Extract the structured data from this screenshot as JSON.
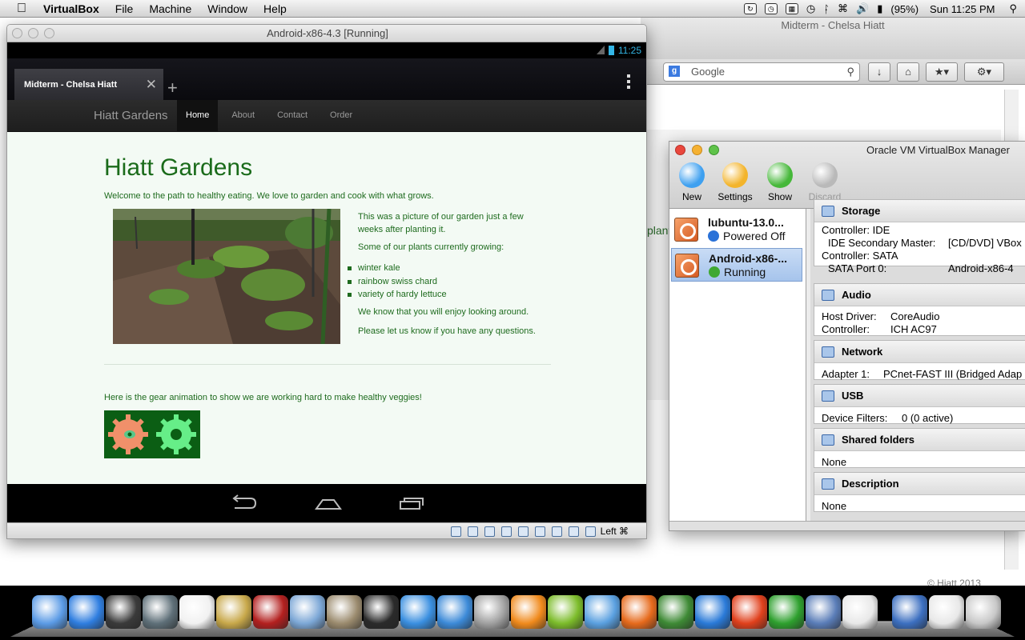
{
  "menubar": {
    "app_name": "VirtualBox",
    "items": [
      "File",
      "Machine",
      "Window",
      "Help"
    ],
    "battery": "(95%)",
    "clock": "Sun 11:25 PM"
  },
  "bg_browser": {
    "title": "Midterm - Chelsa Hiatt",
    "search_placeholder": "Google",
    "partial_text": "plant",
    "footer_text": "© Hiatt 2013"
  },
  "vm_window": {
    "title": "Android-x86-4.3 [Running]",
    "host_key": "Left ⌘",
    "android": {
      "status_time": "11:25",
      "tab_title": "Midterm - Chelsa Hiatt",
      "new_tab": "+",
      "site": {
        "brand": "Hiatt Gardens",
        "nav": [
          "Home",
          "About",
          "Contact",
          "Order"
        ],
        "heading": "Hiatt Gardens",
        "intro": "Welcome to the path to healthy eating. We love to garden and cook with what grows.",
        "caption": "This was a picture of our garden just a few weeks after planting it.",
        "plants_intro": "Some of our plants currently growing:",
        "plants": [
          "winter kale",
          "rainbow swiss chard",
          "variety of hardy lettuce"
        ],
        "enjoy": "We know that you will enjoy looking around.",
        "questions": "Please let us know if you have any questions.",
        "gear_text": "Here is the gear animation to show we are working hard to make healthy veggies!"
      }
    }
  },
  "manager": {
    "title": "Oracle VM VirtualBox Manager",
    "toolbar": [
      {
        "label": "New",
        "color": "#3ea0f0"
      },
      {
        "label": "Settings",
        "color": "#f3b42b"
      },
      {
        "label": "Show",
        "color": "#46b83a"
      },
      {
        "label": "Discard",
        "color": "#b9b9b9"
      }
    ],
    "vms": [
      {
        "name": "lubuntu-13.0...",
        "state": "Powered Off",
        "state_color": "#2a72d8"
      },
      {
        "name": "Android-x86-...",
        "state": "Running",
        "state_color": "#3fa832"
      }
    ],
    "sections": {
      "storage": {
        "title": "Storage",
        "rows": [
          [
            "Controller: IDE",
            ""
          ],
          [
            "IDE Secondary Master:",
            "[CD/DVD] VBox"
          ],
          [
            "Controller: SATA",
            ""
          ],
          [
            "SATA Port 0:",
            "Android-x86-4"
          ]
        ]
      },
      "audio": {
        "title": "Audio",
        "rows": [
          [
            "Host Driver:",
            "CoreAudio"
          ],
          [
            "Controller:",
            "ICH AC97"
          ]
        ]
      },
      "network": {
        "title": "Network",
        "rows": [
          [
            "Adapter 1:",
            "PCnet-FAST III (Bridged Adap"
          ]
        ]
      },
      "usb": {
        "title": "USB",
        "rows": [
          [
            "Device Filters:",
            "0 (0 active)"
          ]
        ]
      },
      "shared": {
        "title": "Shared folders",
        "rows": [
          [
            "None",
            ""
          ]
        ]
      },
      "description": {
        "title": "Description",
        "rows": [
          [
            "None",
            ""
          ]
        ]
      }
    }
  },
  "dock": {
    "apps": [
      {
        "name": "finder-icon",
        "color": "#5b9be6"
      },
      {
        "name": "app-store-icon",
        "color": "#2f7ee0"
      },
      {
        "name": "dashboard-icon",
        "color": "#3a3a3a"
      },
      {
        "name": "time-machine-icon",
        "color": "#5e6f78"
      },
      {
        "name": "calendar-icon",
        "color": "#f1f1f1"
      },
      {
        "name": "imovie-icon",
        "color": "#c8a84a"
      },
      {
        "name": "photo-booth-icon",
        "color": "#b3201f"
      },
      {
        "name": "preview-icon",
        "color": "#7ca7d6"
      },
      {
        "name": "iphoto-icon",
        "color": "#9b8b6e"
      },
      {
        "name": "facetime-icon",
        "color": "#2a2a2a"
      },
      {
        "name": "safari-icon",
        "color": "#3a8fe0"
      },
      {
        "name": "itunes-icon",
        "color": "#3c8ad8"
      },
      {
        "name": "script-editor-icon",
        "color": "#a0a0a0"
      },
      {
        "name": "vlc-icon",
        "color": "#f08a1c"
      },
      {
        "name": "spotify-icon",
        "color": "#7cbc2a"
      },
      {
        "name": "messenger-icon",
        "color": "#5aa0e0"
      },
      {
        "name": "firefox-icon",
        "color": "#e66a1c"
      },
      {
        "name": "evernote-icon",
        "color": "#3e8a35"
      },
      {
        "name": "word-icon",
        "color": "#2a7ad8"
      },
      {
        "name": "powerpoint-icon",
        "color": "#e0401c"
      },
      {
        "name": "excel-icon",
        "color": "#2ea02e"
      },
      {
        "name": "virtualbox-icon",
        "color": "#5a7db8"
      },
      {
        "name": "terminal-icon",
        "color": "#e8e8e8"
      },
      {
        "name": "downloads-stack-icon",
        "color": "#3c6fc0"
      },
      {
        "name": "documents-stack-icon",
        "color": "#e8e8e8"
      },
      {
        "name": "trash-icon",
        "color": "#c8c8c8"
      }
    ]
  }
}
